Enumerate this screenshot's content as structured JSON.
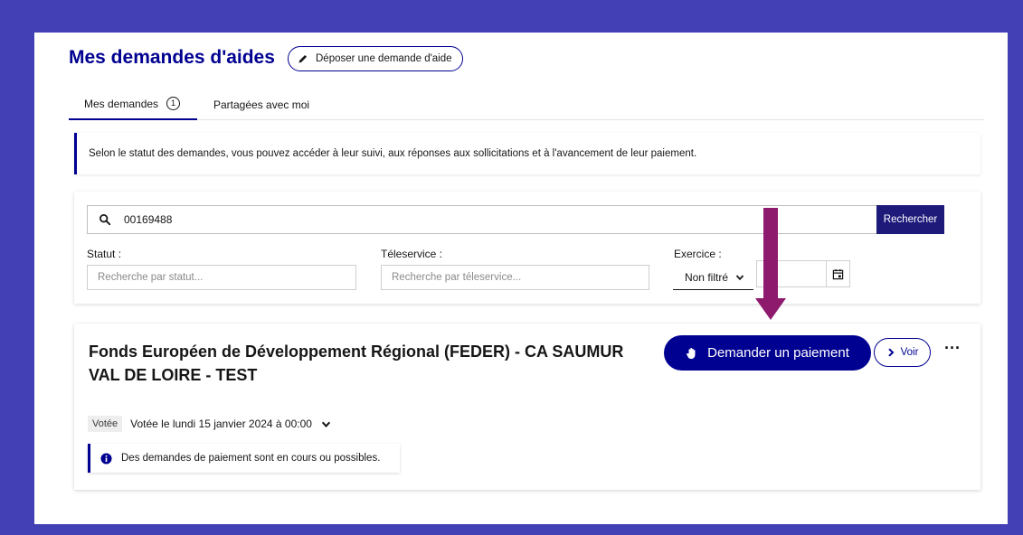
{
  "header": {
    "title": "Mes demandes d'aides",
    "deposit_label": "Déposer une demande d'aide"
  },
  "tabs": [
    {
      "label": "Mes demandes",
      "count": "1"
    },
    {
      "label": "Partagées avec moi"
    }
  ],
  "info_banner": "Selon le statut des demandes, vous pouvez accéder à leur suivi, aux réponses aux sollicitations et à l'avancement de leur paiement.",
  "filters": {
    "search_value": "00169488",
    "search_button": "Rechercher",
    "statut_label": "Statut :",
    "statut_placeholder": "Recherche par statut...",
    "teleservice_label": "Téleservice :",
    "teleservice_placeholder": "Recherche par téleservice...",
    "exercice_label": "Exercice :",
    "exercice_value": "Non filtré"
  },
  "card": {
    "title": "Fonds Européen de Développement Régional (FEDER) - CA SAUMUR VAL DE LOIRE - TEST",
    "pay_button": "Demander un paiement",
    "voir_button": "Voir",
    "more": "···",
    "status_badge": "Votée",
    "status_text": "Votée le lundi 15 janvier 2024 à 00:00",
    "pay_info": "Des demandes de paiement sont en cours ou possibles."
  },
  "colors": {
    "background": "#4340b6",
    "primary": "#000091",
    "annotation_arrow": "#8e1a6e"
  }
}
